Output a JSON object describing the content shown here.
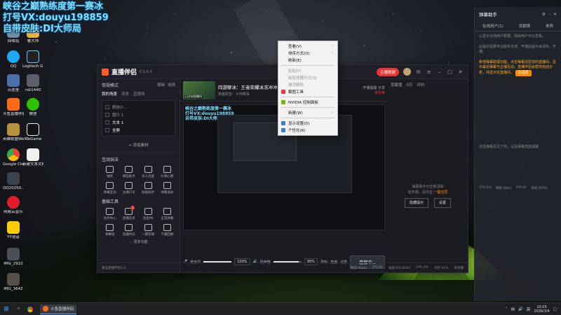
{
  "overlay": {
    "line1": "峡谷之巅熟练度第一赛冰",
    "line2": "打号VX:douyu198859",
    "line3": "自带皮肤:DI大师局"
  },
  "desktop_icons": [
    {
      "label": "回收站"
    },
    {
      "label": "鲁大师"
    },
    {
      "label": "QQ"
    },
    {
      "label": "Logitech G HUB"
    },
    {
      "label": "点这里"
    },
    {
      "label": "rsk1440"
    },
    {
      "label": "斗鱼直播伴侣"
    },
    {
      "label": "微信"
    },
    {
      "label": "英雄联盟WeGame版"
    },
    {
      "label": "WeGame"
    },
    {
      "label": "Google Chrome"
    },
    {
      "label": "新建文本文档"
    },
    {
      "label": "QQ20250..."
    },
    {
      "label": "网易云音乐"
    },
    {
      "label": "YY语音"
    },
    {
      "label": "IMG_2910"
    },
    {
      "label": "IMG_3642"
    }
  ],
  "app": {
    "name": "直播伴侣",
    "version": "6.5.6.4",
    "live_badge": "主播数据",
    "left": {
      "mode": "常规模式",
      "mode_right": "编辑",
      "mode_right2": "选择",
      "tabs": [
        "我的场景",
        "场景",
        "直播场"
      ],
      "scenes": [
        {
          "label": "微信小...",
          "active": false
        },
        {
          "label": "图片 1",
          "active": false
        },
        {
          "label": "文本 1",
          "active": true
        },
        {
          "label": "全屏",
          "active": true
        }
      ],
      "add_source": "+ 添加素材",
      "interact_title": "互动玩法",
      "interact_tools": [
        "抽奖",
        "哪些助手",
        "多人连麦",
        "礼物心愿",
        "弹幕互动",
        "主播口令",
        "贴贴助手",
        "弹幕滚屏"
      ],
      "basic_title": "基础工具",
      "basic_tools": [
        "任务中心",
        "直播任务",
        "连麦PK",
        "正常弹幕",
        "弹幕墙",
        "直播时长",
        "一键剪辑",
        "下播回顾"
      ],
      "basic_badge": "1",
      "more": "··· 更多功能"
    },
    "room": {
      "thumb_label": "已开启直播间",
      "title": "同游聊冰：王者荣耀冰冻冲冲冲",
      "subtitle": "英雄联盟 · 大神赛事",
      "right1": "开播提醒",
      "right2": "分享",
      "right3": "未结束"
    },
    "preview_wm": [
      "峡谷之巅熟练度第一赛冰",
      "打号VX:douyu198859",
      "自带皮肤:DI大师局"
    ],
    "controls": {
      "mic_label": "麦克风",
      "mic_pct": "100%",
      "speaker_label": "扬声器",
      "speaker_pct": "90%",
      "mic_level": 1.0,
      "speaker_level": 0.9,
      "btn_a": "录制",
      "btn_b": "直播",
      "btn_c": "设置",
      "start": "连接中..."
    },
    "status": [
      "建议直播伴侣2.0",
      "网络:0kb/s",
      "FPS:60",
      "丢帧:0(0.00%)",
      "CPU:2%",
      "内存:11%",
      "未开播"
    ],
    "right": {
      "tabs": [
        "贡献值",
        "0万",
        "评价"
      ],
      "empty_line1": "弹幕助手已全部清除",
      "empty_line2": "如无误，请点击",
      "empty_link": "一键还原",
      "btn_a": "隐藏提示",
      "btn_b": "设置"
    }
  },
  "context_menu": [
    {
      "label": "查看(V)",
      "arrow": true,
      "dim": false
    },
    {
      "label": "排序方式(O)",
      "arrow": true,
      "dim": false
    },
    {
      "label": "刷新(E)",
      "arrow": false,
      "dim": false
    },
    {
      "sep": true
    },
    {
      "label": "粘贴(P)",
      "arrow": false,
      "dim": true
    },
    {
      "label": "粘贴快捷方式(S)",
      "arrow": false,
      "dim": true
    },
    {
      "label": "撤消删除",
      "arrow": false,
      "dim": true
    },
    {
      "label": "截图工具",
      "arrow": false,
      "dim": false,
      "icon": "#e34"
    },
    {
      "sep": true
    },
    {
      "label": "NVIDIA 控制面板",
      "arrow": false,
      "dim": false,
      "icon": "#76b900"
    },
    {
      "sep": true
    },
    {
      "label": "新建(W)",
      "arrow": true,
      "dim": false
    },
    {
      "sep": true
    },
    {
      "label": "显示设置(D)",
      "arrow": false,
      "dim": false,
      "icon": "#3a7bd5"
    },
    {
      "label": "个性化(R)",
      "arrow": false,
      "dim": false,
      "icon": "#3a7bd5"
    }
  ],
  "side_panel": {
    "title": "弹幕助手",
    "tabs": [
      "在线用户(1)",
      "贡献榜",
      "贵宾"
    ],
    "text1": "以显示在线用户数据，高级用户可以查看。",
    "text2": "此提示需要专业版本支持，开播后提示会消失，开播。",
    "text3": "新增弹幕助理功能，点击弹幕还原您的直播间，显示最近弹幕与主播互动，直播伴侣会帮你自动分析，并显示在直播间。",
    "btn": "去设置",
    "text4": "点击弹幕关注了你，以及弹幕高能提醒",
    "stats": [
      "CPU:2%",
      "网络:0kb/s",
      "FPS:60",
      "丢帧:0(0%)"
    ]
  },
  "taskbar": {
    "app": "斗鱼直播伴侣",
    "ime": "英",
    "time": "10:05",
    "date": "2026/3/4"
  }
}
